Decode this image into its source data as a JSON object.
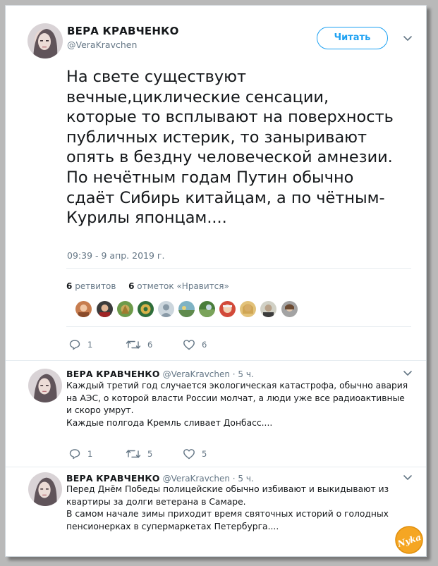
{
  "tweet": {
    "author_name": "ВЕРА КРАВЧЕНКО",
    "author_handle": "@VeraKravchen",
    "follow_label": "Читать",
    "text_lines": [
      "На свете существуют",
      "вечные,циклические сенсации,",
      "которые то всплывают на поверхность",
      "публичных истерик, то заныривают",
      "опять в бездну человеческой амнезии.",
      "По нечётным годам Путин обычно",
      "сдаёт Сибирь китайцам, а по чётным-",
      "Курилы японцам...."
    ],
    "timestamp": "09:39 - 9 апр. 2019 г.",
    "retweets_count": "6",
    "retweets_label": "ретвитов",
    "likes_count": "6",
    "likes_label": "отметок «Нравится»",
    "replies": "1",
    "retweets": "6",
    "likes": "6"
  },
  "replies": [
    {
      "author_name": "ВЕРА КРАВЧЕНКО",
      "meta": "@VeraKravchen · 5 ч.",
      "text_lines": [
        "Каждый третий год случается экологическая катастрофа, обычно авария",
        "на АЭС, о которой власти России молчат, а люди уже все радиоактивные",
        "и скоро умрут.",
        "Каждые полгода Кремль сливает Донбасс...."
      ],
      "replies": "1",
      "retweets": "5",
      "likes": "5"
    },
    {
      "author_name": "ВЕРА КРАВЧЕНКО",
      "meta": "@VeraKravchen · 5 ч.",
      "text_lines": [
        "Перед Днём Победы полицейские обычно избивают и выкидывают из",
        "квартиры за долги ветерана в Самаре.",
        "В самом начале зимы приходит время святочных историй о голодных",
        "пенсионерках в супермаркетах Петербурга...."
      ]
    }
  ],
  "logo_text": "Nyka",
  "colors": {
    "accent": "#1da1f2",
    "text": "#14171a",
    "muted": "#657786",
    "logo": "#f5a623"
  },
  "icons": {
    "reply": "reply-icon",
    "retweet": "retweet-icon",
    "like": "heart-icon",
    "caret": "chevron-down-icon"
  }
}
